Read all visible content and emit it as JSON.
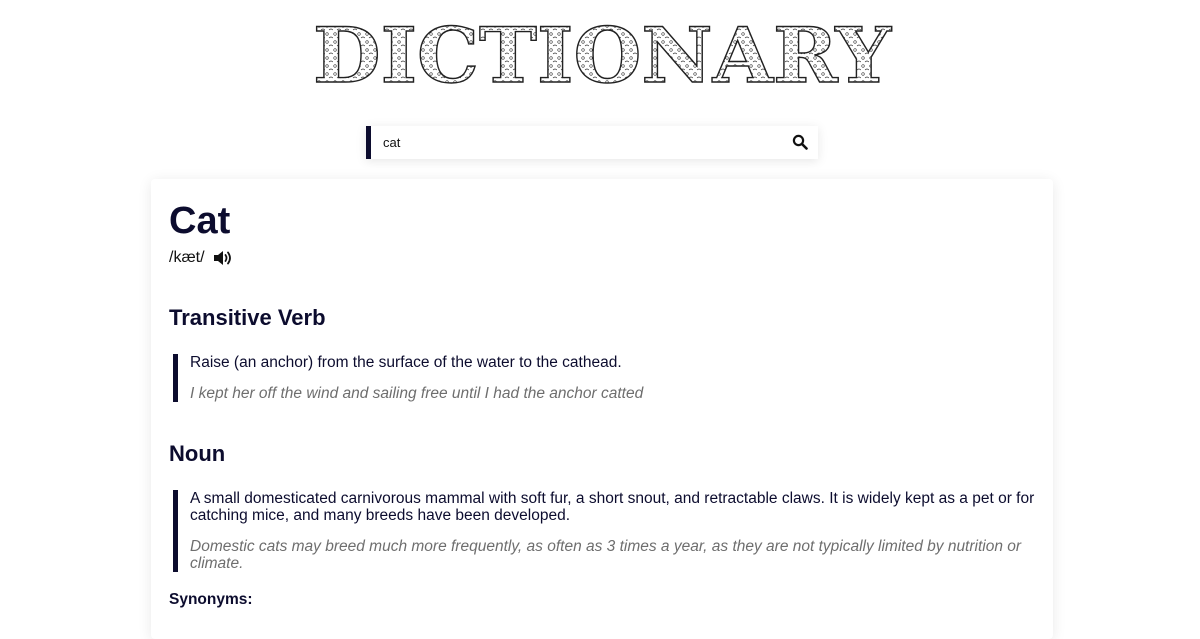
{
  "app": {
    "logo_text": "DICTIONARY"
  },
  "search": {
    "value": "cat",
    "placeholder": "",
    "button_icon": "search-icon"
  },
  "entry": {
    "word": "Cat",
    "phonetic": "/kæt/",
    "audio_icon": "speaker-icon",
    "meanings": [
      {
        "part_of_speech": "Transitive Verb",
        "definition": "Raise (an anchor) from the surface of the water to the cathead.",
        "example": "I kept her off the wind and sailing free until I had the anchor catted"
      },
      {
        "part_of_speech": "Noun",
        "definition": "A small domesticated carnivorous mammal with soft fur, a short snout, and retractable claws. It is widely kept as a pet or for catching mice, and many breeds have been developed.",
        "example": "Domestic cats may breed much more frequently, as often as 3 times a year, as they are not typically limited by nutrition or climate."
      }
    ],
    "synonyms_label": "Synonyms:"
  },
  "colors": {
    "accent": "#0c0c2e",
    "example_text": "#6e6e6e"
  }
}
